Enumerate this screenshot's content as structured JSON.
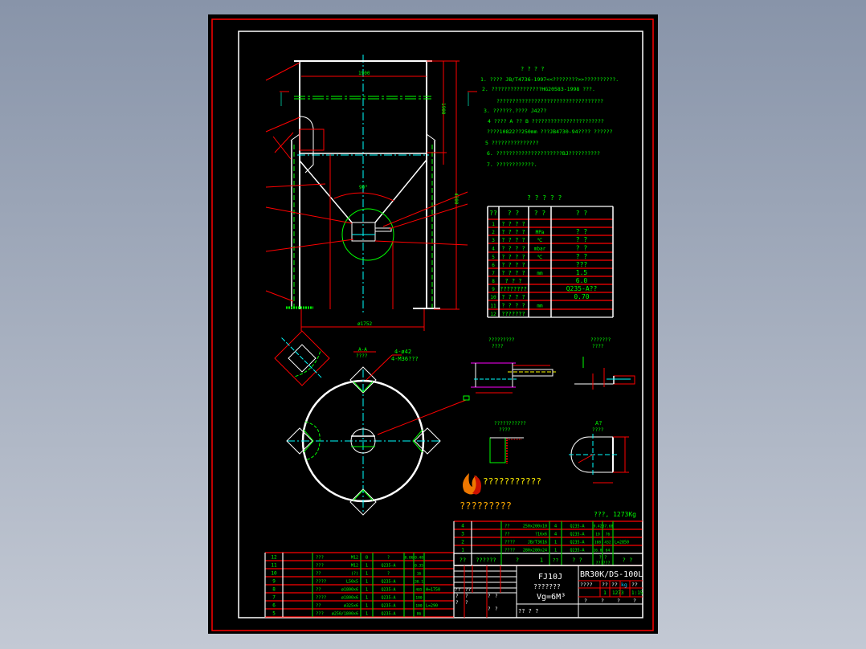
{
  "colors": {
    "background": "#000000",
    "frame": "#ff0000",
    "border": "#ffffff",
    "text": "#00ff00",
    "centerline": "#00ffff",
    "logo_text": "#ffee00"
  },
  "notes": {
    "title": "? ? ? ?",
    "lines": [
      "1. ????  JB/T4736-1997<<????????>>??????????.",
      "2. ????????????????HG20583-1998 ???.",
      "??????????????????????????????????",
      "3. ??????.????    J427?",
      "4  ???? A ?? B ???????????????????????",
      "????10822??250mm ???JB4730-94???? ??????",
      "5  ???????????????",
      "6. ?????????????????????BJ??????????",
      "7. ????????????."
    ]
  },
  "param_table": {
    "title": "? ? ? ? ?",
    "headers": [
      "??",
      "?   ?",
      "?    ?",
      "?                ?"
    ],
    "rows": [
      {
        "no": "1",
        "name": "? ? ? ?",
        "unit": "",
        "value": ""
      },
      {
        "no": "2",
        "name": "? ? ? ?",
        "unit": "MPa",
        "value": "?  ?"
      },
      {
        "no": "3",
        "name": "? ? ? ?",
        "unit": "℃",
        "value": "?  ?"
      },
      {
        "no": "4",
        "name": "? ? ? ?",
        "unit": "mbar",
        "value": "?  ?"
      },
      {
        "no": "5",
        "name": "? ? ? ?",
        "unit": "℃",
        "value": "?  ?"
      },
      {
        "no": "6",
        "name": "? ? ? ?",
        "unit": "",
        "value": "???"
      },
      {
        "no": "7",
        "name": "? ? ? ?",
        "unit": "mm",
        "value": "1.5"
      },
      {
        "no": "8",
        "name": "?  ?  ?",
        "unit": "",
        "value": "6.0"
      },
      {
        "no": "9",
        "name": "????????",
        "unit": "",
        "value": "Q235-A??"
      },
      {
        "no": "10",
        "name": "? ? ? ?",
        "unit": "",
        "value": "0.70"
      },
      {
        "no": "11",
        "name": "? ? ? ?",
        "unit": "mm",
        "value": ""
      },
      {
        "no": "12",
        "name": "???????",
        "unit": "",
        "value": ""
      }
    ]
  },
  "parts_left": [
    {
      "no": "12",
      "name": "???",
      "spec": "M12",
      "qty": "8",
      "mat": "?",
      "w1": "0.06",
      "w2": "0.48",
      "note": ""
    },
    {
      "no": "11",
      "name": "???",
      "spec": "M12",
      "qty": "1",
      "mat": "Q235-A",
      "w1": "",
      "w2": "0.35",
      "note": ""
    },
    {
      "no": "10",
      "name": "??",
      "spec": "(?)",
      "qty": "1",
      "mat": "?",
      "w1": "",
      "w2": "16",
      "note": ""
    },
    {
      "no": "9",
      "name": "????",
      "spec": "L50x5",
      "qty": "1",
      "mat": "Q235-A",
      "w1": "",
      "w2": "30.1",
      "note": ""
    },
    {
      "no": "8",
      "name": "??",
      "spec": "ø1800x6",
      "qty": "1",
      "mat": "Q235-A",
      "w1": "",
      "w2": "405",
      "note": "H=1750"
    },
    {
      "no": "7",
      "name": "????",
      "spec": "ø1800x6",
      "qty": "1",
      "mat": "Q235-A",
      "w1": "",
      "w2": "180",
      "note": ""
    },
    {
      "no": "6",
      "name": "??",
      "spec": "ø325x6",
      "qty": "1",
      "mat": "Q235-A",
      "w1": "",
      "w2": "100",
      "note": "L=290"
    },
    {
      "no": "5",
      "name": "???",
      "spec": "ø250/1800x6",
      "qty": "1",
      "mat": "Q235-A",
      "w1": "",
      "w2": "86",
      "note": ""
    }
  ],
  "parts_right": [
    {
      "no": "4",
      "name": "??",
      "spec": "250x200x10",
      "qty": "4",
      "mat": "Q235-A",
      "w1": "9.42",
      "w2": "37.68",
      "note": ""
    },
    {
      "no": "3",
      "name": "??",
      "spec": "?16x6",
      "qty": "4",
      "mat": "Q235-A",
      "w1": "19",
      "w2": "76",
      "note": ""
    },
    {
      "no": "2",
      "name": "????",
      "spec": "JB/T3616",
      "qty": "1",
      "mat": "Q235-A",
      "w1": "108",
      "w2": "432",
      "note": "L=2850"
    },
    {
      "no": "1",
      "name": "????",
      "spec": "280x280x24",
      "qty": "1",
      "mat": "Q235-A",
      "w1": "16.0",
      "w2": "64",
      "note": ""
    }
  ],
  "parts_header": {
    "no": "??",
    "drawing": "??????",
    "name": "?",
    "spec": "1",
    "qty": "??",
    "mat": "?  ?",
    "weight": "?  ?",
    "weight_sub": "??????",
    "note": "?  ?"
  },
  "total_weight": "???, 1273Kg",
  "title_block": {
    "product": "FJ10J",
    "product_name": "???????",
    "volume": "Vg=6M³",
    "drawing_no": "BR30K/DS-100L",
    "col_labels": [
      "????",
      "??",
      "??",
      "kg",
      "??"
    ],
    "values": [
      "1",
      "1273",
      "1:15"
    ],
    "bottom_labels": [
      "?",
      "?",
      "?",
      "?"
    ],
    "company_row": "??     ? ?",
    "sign_labels": [
      "??",
      "??",
      "?",
      "?",
      "?",
      "?",
      "?",
      "?",
      "?",
      "?"
    ]
  },
  "views": {
    "main_dim_top": "1900",
    "main_dim_bottom": "ø1752",
    "main_dim_height": "4300",
    "main_dim_upper": "1900",
    "cone_angle": "90°",
    "plan_hole_note_1": "4-ø42",
    "plan_hole_note_2": "4-M36???",
    "plan_label": "A-A",
    "plan_sub": "????",
    "detail1_title": "?????????",
    "detail1_sub": "????",
    "detail2_title": "???????",
    "detail2_sub": "????",
    "detail3_title": "???????????",
    "detail3_sub": "????",
    "detail4_title": "A?",
    "detail4_sub": "????"
  },
  "logo": {
    "text_top": "???????????",
    "text_bottom": "?????????"
  }
}
